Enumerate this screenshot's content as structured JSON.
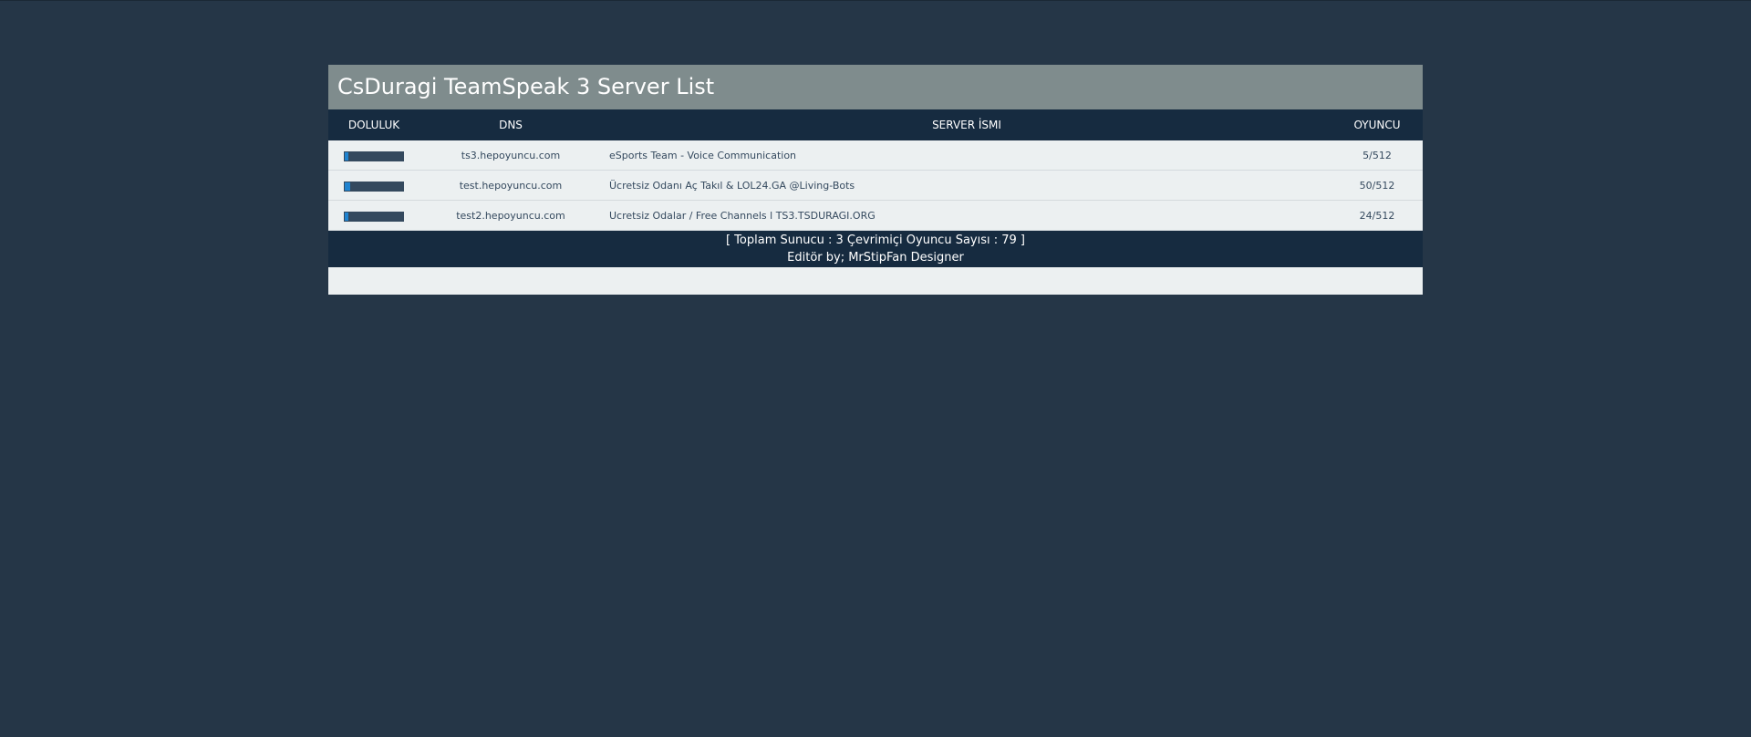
{
  "title": "CsDuragi TeamSpeak 3 Server List",
  "columns": {
    "fill": "DOLULUK",
    "dns": "DNS",
    "name": "SERVER İSMI",
    "players": "OYUNCU"
  },
  "servers": [
    {
      "dns": "ts3.hepoyuncu.com",
      "name": "eSports Team - Voice Communication",
      "players": "5/512",
      "fill_fraction": 0.0098
    },
    {
      "dns": "test.hepoyuncu.com",
      "name": "Ücretsiz Odanı Aç Takıl & LOL24.GA @Living-Bots",
      "players": "50/512",
      "fill_fraction": 0.0977
    },
    {
      "dns": "test2.hepoyuncu.com",
      "name": "Ucretsiz Odalar / Free Channels l TS3.TSDURAGI.ORG",
      "players": "24/512",
      "fill_fraction": 0.0469
    }
  ],
  "footer": {
    "summary": "[ Toplam Sunucu : 3 Çevrimiçi Oyuncu Sayısı : 79 ]",
    "editor": "Editör by; MrStipFan Designer"
  },
  "colors": {
    "background": "#253647",
    "title_bar": "#7f8c8d",
    "header": "#162b40",
    "row": "#ecf0f1",
    "fill_track": "#34495e",
    "fill_bar": "#1f83cf"
  }
}
